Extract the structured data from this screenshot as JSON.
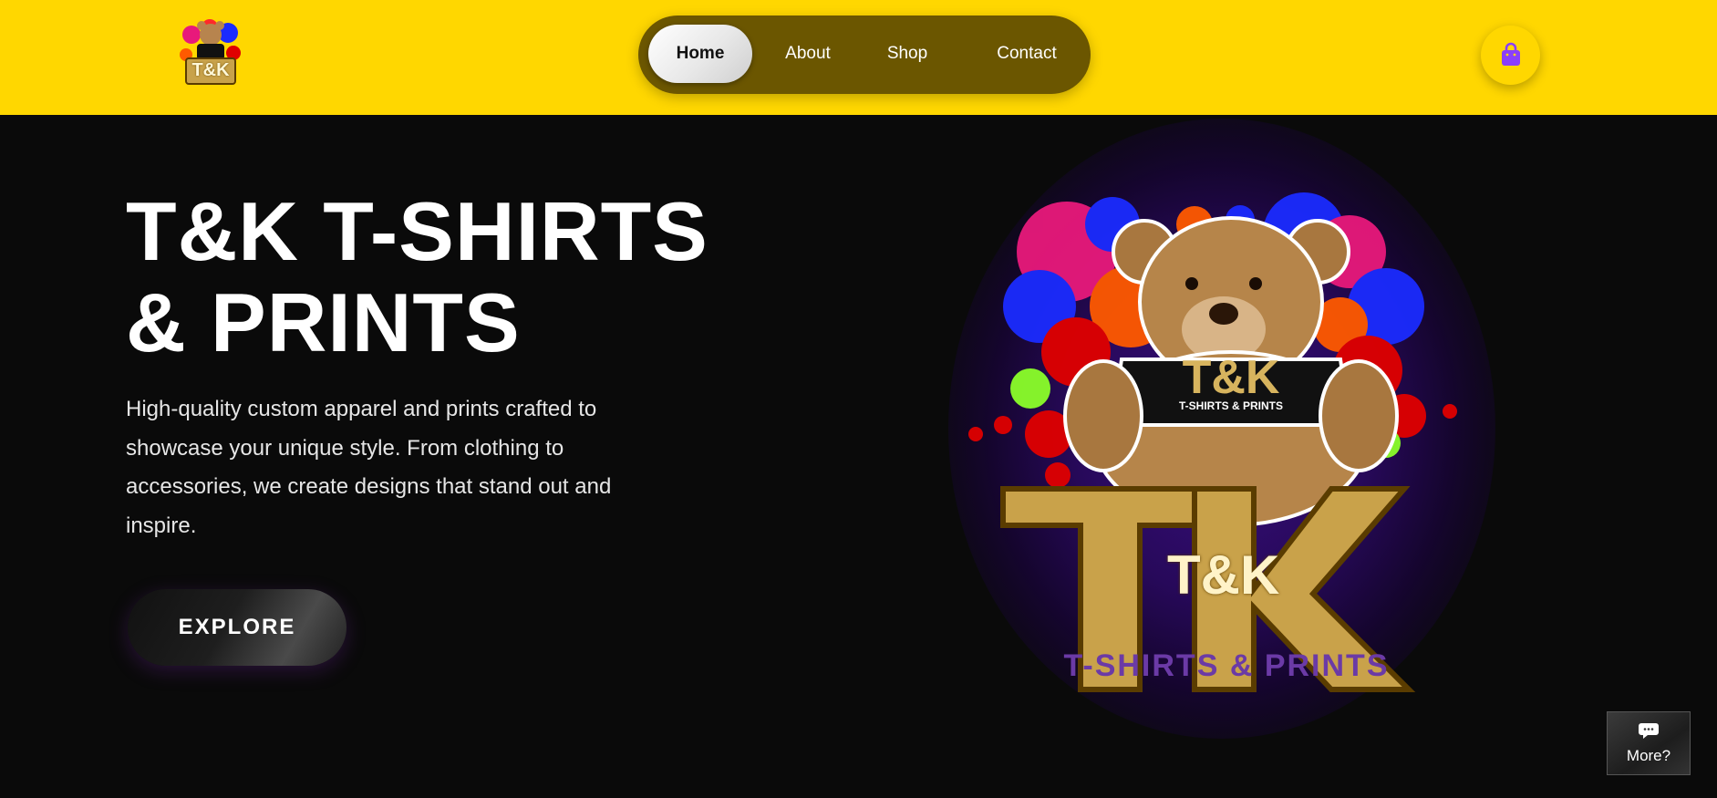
{
  "header": {
    "logo_text": "T&K",
    "nav": [
      {
        "label": "Home",
        "active": true
      },
      {
        "label": "About",
        "active": false
      },
      {
        "label": "Shop",
        "active": false
      },
      {
        "label": "Contact",
        "active": false
      }
    ],
    "cart_icon": "shopping-bag-icon"
  },
  "hero": {
    "title_line1": "T&K T-SHIRTS",
    "title_line2": "& PRINTS",
    "description": "High-quality custom apparel and prints crafted to showcase your unique style. From clothing to accessories, we create designs that stand out and inspire.",
    "button_label": "EXPLORE",
    "art": {
      "logo_text": "T&K",
      "shirt_text": "T&K",
      "shirt_subtext": "T-SHIRTS & PRINTS",
      "tagline": "T-SHIRTS & PRINTS"
    }
  },
  "chat": {
    "label": "More?",
    "icon": "chat-bubble-icon"
  },
  "colors": {
    "header_bg": "#ffd700",
    "nav_bg": "#6b5600",
    "page_bg": "#0a0a0a",
    "accent_purple": "#8a3ffc"
  }
}
